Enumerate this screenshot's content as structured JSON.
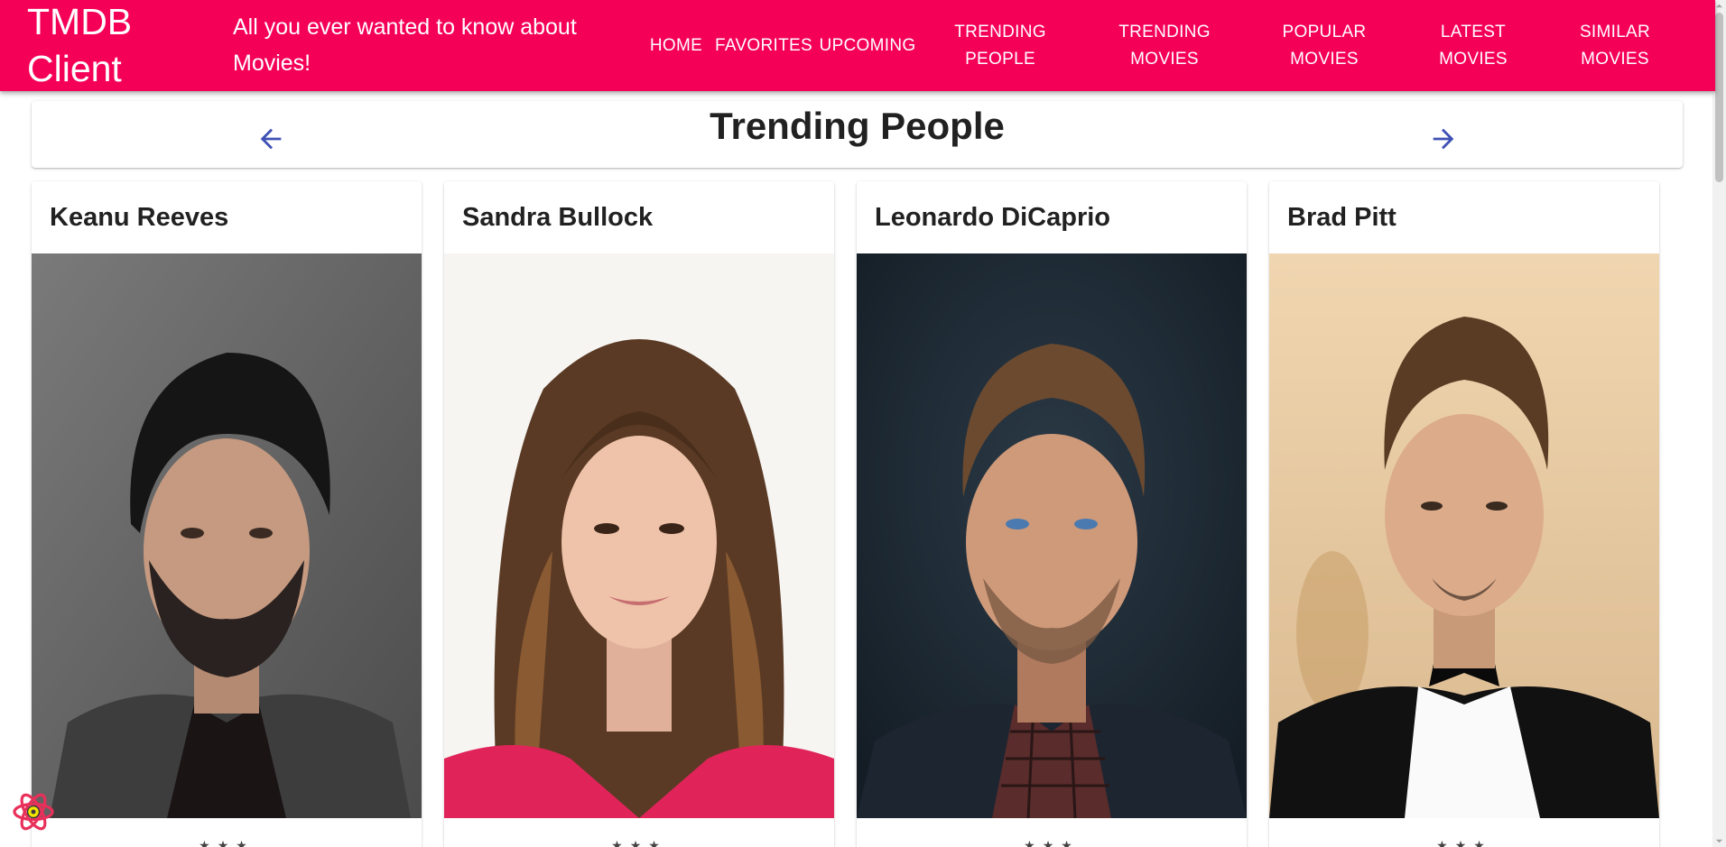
{
  "appbar": {
    "brand": "TMDB Client",
    "tagline": "All you ever wanted to know about Movies!",
    "nav": [
      {
        "label": "HOME"
      },
      {
        "label": "FAVORITES"
      },
      {
        "label": "UPCOMING"
      },
      {
        "label": "TRENDING PEOPLE"
      },
      {
        "label": "TRENDING MOVIES"
      },
      {
        "label": "POPULAR MOVIES"
      },
      {
        "label": "LATEST MOVIES"
      },
      {
        "label": "SIMILAR MOVIES"
      }
    ],
    "color": "#f50057"
  },
  "section": {
    "title": "Trending People",
    "prev_icon": "arrow-back-icon",
    "next_icon": "arrow-forward-icon",
    "arrow_color": "#3f51b5"
  },
  "people": [
    {
      "name": "Keanu Reeves",
      "photo_icon": "portrait-photo",
      "bg": "#6b6b6b"
    },
    {
      "name": "Sandra Bullock",
      "photo_icon": "portrait-photo",
      "bg": "#f7f5f2"
    },
    {
      "name": "Leonardo DiCaprio",
      "photo_icon": "portrait-photo",
      "bg": "#1e2a35"
    },
    {
      "name": "Brad Pitt",
      "photo_icon": "portrait-photo",
      "bg": "#e5c9a0"
    }
  ],
  "devtools": {
    "icon": "react-devtools-icon"
  }
}
